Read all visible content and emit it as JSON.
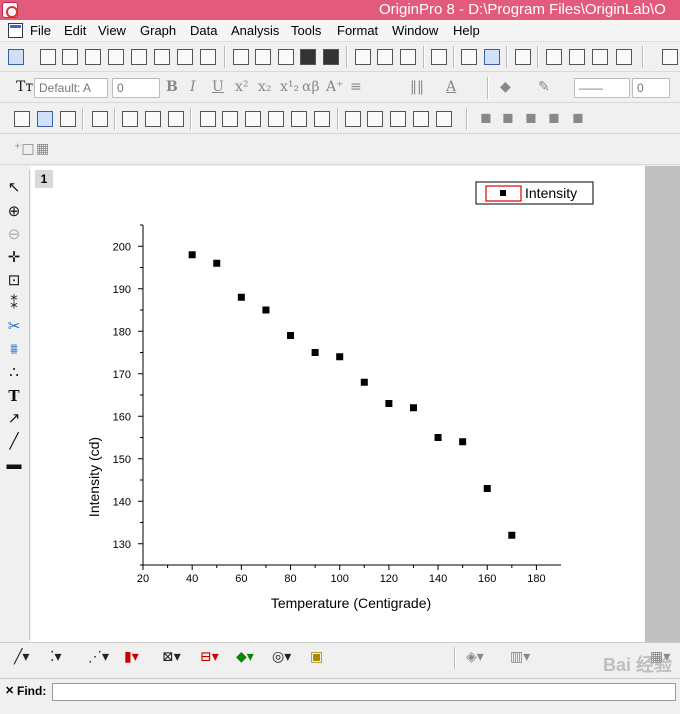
{
  "window": {
    "title": "OriginPro 8 - D:\\Program Files\\OriginLab\\O"
  },
  "menu": [
    "File",
    "Edit",
    "View",
    "Graph",
    "Data",
    "Analysis",
    "Tools",
    "Format",
    "Window",
    "Help"
  ],
  "format_toolbar": {
    "font": "Default: A",
    "size": "0",
    "line_width": "0"
  },
  "graph": {
    "layer_label": "1"
  },
  "left_tools": {
    "text_tool": "T"
  },
  "find": {
    "label": "Find:",
    "value": ""
  },
  "watermark": "Bai 经验",
  "chart_data": {
    "type": "scatter",
    "xlabel": "Temperature (Centigrade)",
    "ylabel": "Intensity (cd)",
    "xlim": [
      20,
      190
    ],
    "ylim": [
      125,
      205
    ],
    "xticks": [
      20,
      40,
      60,
      80,
      100,
      120,
      140,
      160,
      180
    ],
    "yticks": [
      130,
      140,
      150,
      160,
      170,
      180,
      190,
      200
    ],
    "legend_position": "top-right",
    "series": [
      {
        "name": "Intensity",
        "marker": "square",
        "color": "#000000",
        "x": [
          40,
          50,
          60,
          70,
          80,
          90,
          100,
          110,
          120,
          130,
          140,
          150,
          160,
          170
        ],
        "y": [
          198,
          196,
          188,
          185,
          179,
          175,
          174,
          168,
          163,
          162,
          155,
          154,
          143,
          132
        ]
      }
    ]
  }
}
